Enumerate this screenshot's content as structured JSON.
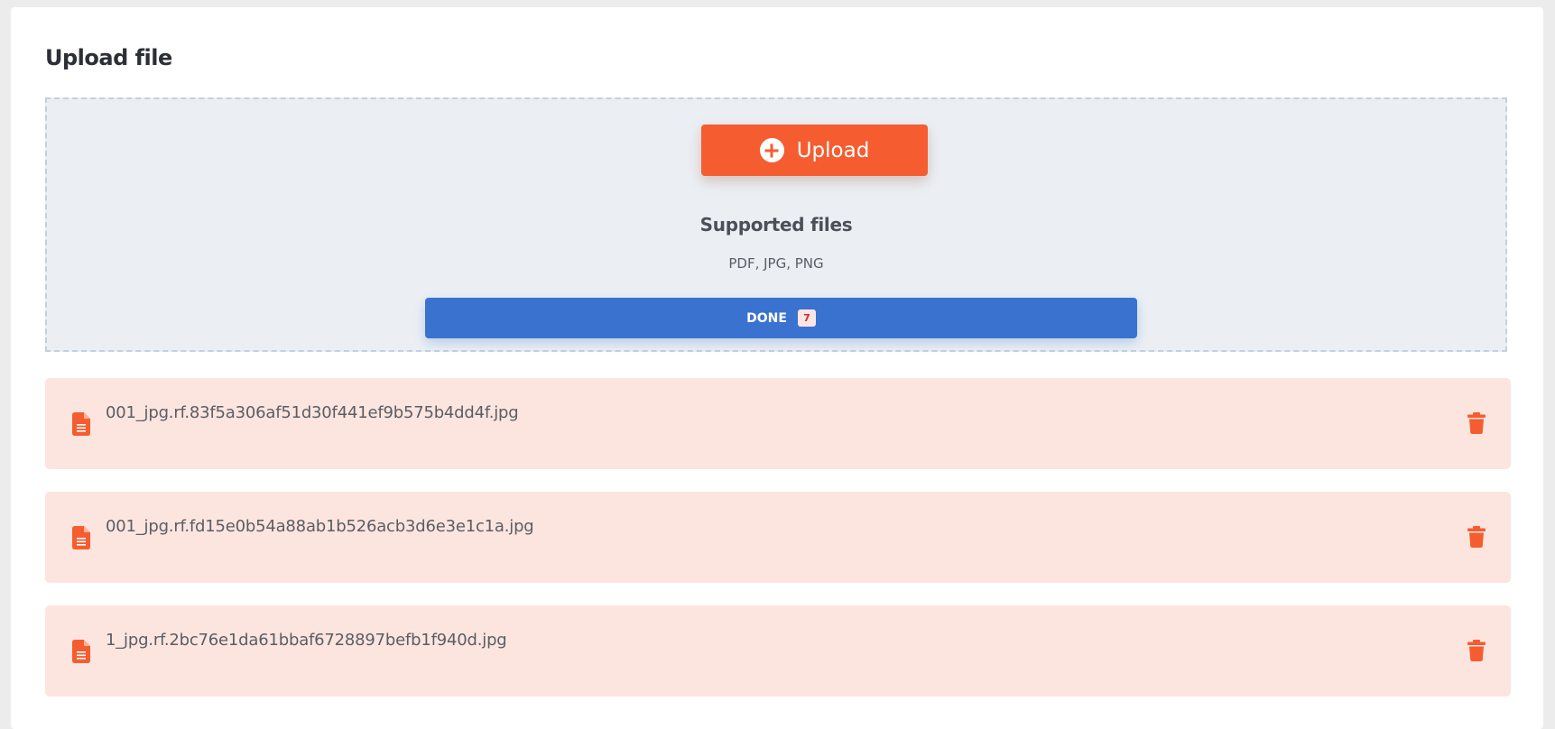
{
  "page": {
    "title": "Upload file"
  },
  "dropzone": {
    "upload_button_label": "Upload",
    "upload_icon": "plus-circle-icon",
    "supported_title": "Supported files",
    "supported_types": "PDF, JPG, PNG",
    "done_button_label": "DONE",
    "done_count": "7"
  },
  "files": [
    {
      "name": "001_jpg.rf.83f5a306af51d30f441ef9b575b4dd4f.jpg",
      "icon": "file-icon",
      "delete_icon": "trash-icon"
    },
    {
      "name": "001_jpg.rf.fd15e0b54a88ab1b526acb3d6e3e1c1a.jpg",
      "icon": "file-icon",
      "delete_icon": "trash-icon"
    },
    {
      "name": "1_jpg.rf.2bc76e1da61bbaf6728897befb1f940d.jpg",
      "icon": "file-icon",
      "delete_icon": "trash-icon"
    }
  ],
  "colors": {
    "accent_orange": "#f55d30",
    "accent_blue": "#3a72cf",
    "file_row_background": "#fde5df",
    "dropzone_background": "#ebeff4"
  }
}
